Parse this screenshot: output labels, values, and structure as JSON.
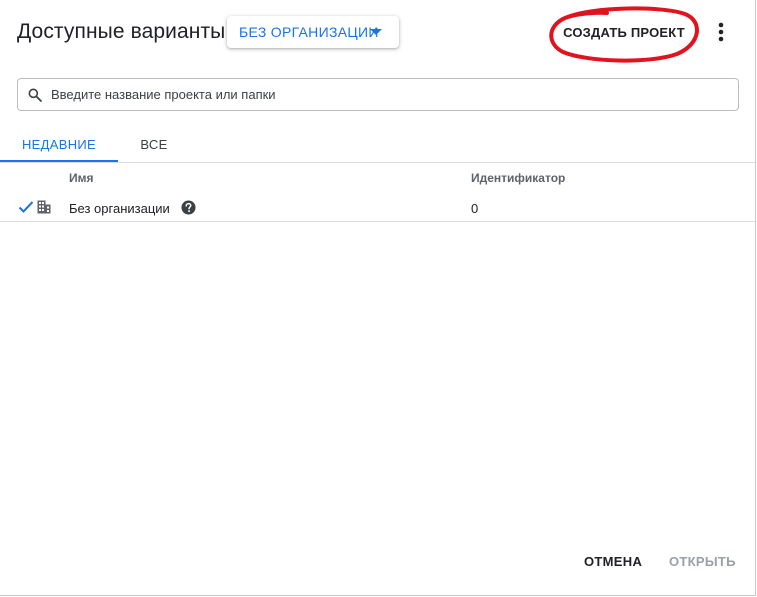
{
  "header": {
    "title": "Доступные варианты:",
    "org_select": "БЕЗ ОРГАНИЗАЦИИ",
    "create_button": "СОЗДАТЬ ПРОЕКТ"
  },
  "search": {
    "placeholder": "Введите название проекта или папки",
    "value": ""
  },
  "tabs": [
    {
      "label": "НЕДАВНИЕ",
      "active": true
    },
    {
      "label": "ВСЕ",
      "active": false
    }
  ],
  "table": {
    "columns": [
      "Имя",
      "Идентификатор"
    ],
    "rows": [
      {
        "name": "Без организации",
        "id": "0",
        "selected": true,
        "icon": "building-icon"
      }
    ]
  },
  "footer": {
    "cancel": "ОТМЕНА",
    "open": "ОТКРЫТЬ"
  },
  "colors": {
    "accent": "#1a73e8",
    "annotation": "#e0141e",
    "disabled": "#9aa0a6"
  }
}
